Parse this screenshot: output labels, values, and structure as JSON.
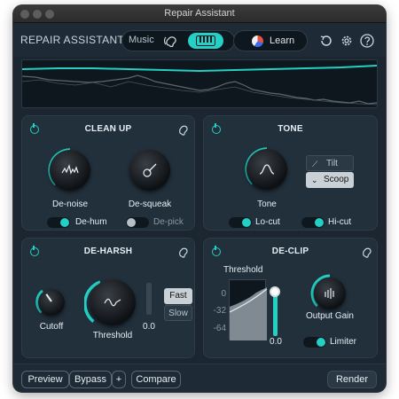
{
  "window": {
    "title": "Repair Assistant"
  },
  "header": {
    "app_title": "REPAIR ASSISTANT",
    "mode_label": "Music",
    "learn_label": "Learn"
  },
  "cleanup": {
    "title": "CLEAN UP",
    "denoise_label": "De-noise",
    "desqueak_label": "De-squeak",
    "dehum_label": "De-hum",
    "depick_label": "De-pick"
  },
  "tone": {
    "title": "TONE",
    "tone_label": "Tone",
    "tilt_label": "Tilt",
    "scoop_label": "Scoop",
    "locut_label": "Lo-cut",
    "hicut_label": "Hi-cut"
  },
  "deharsh": {
    "title": "DE-HARSH",
    "cutoff_label": "Cutoff",
    "threshold_label": "Threshold",
    "threshold_value": "0.0",
    "fast_label": "Fast",
    "slow_label": "Slow"
  },
  "declip": {
    "title": "DE-CLIP",
    "threshold_label": "Threshold",
    "scale": [
      "0",
      "-32",
      "-64"
    ],
    "value": "0.0",
    "output_gain_label": "Output Gain",
    "limiter_label": "Limiter"
  },
  "footer": {
    "preview_label": "Preview",
    "bypass_label": "Bypass",
    "plus_label": "+",
    "compare_label": "Compare",
    "render_label": "Render"
  },
  "colors": {
    "accent": "#24cfc4",
    "bg": "#1b2630",
    "panel": "#22303c"
  },
  "icons": {
    "ear": "ear-icon",
    "piano": "piano-icon",
    "history": "history-icon",
    "settings": "gear-icon",
    "help": "help-icon",
    "power": "power-icon"
  }
}
